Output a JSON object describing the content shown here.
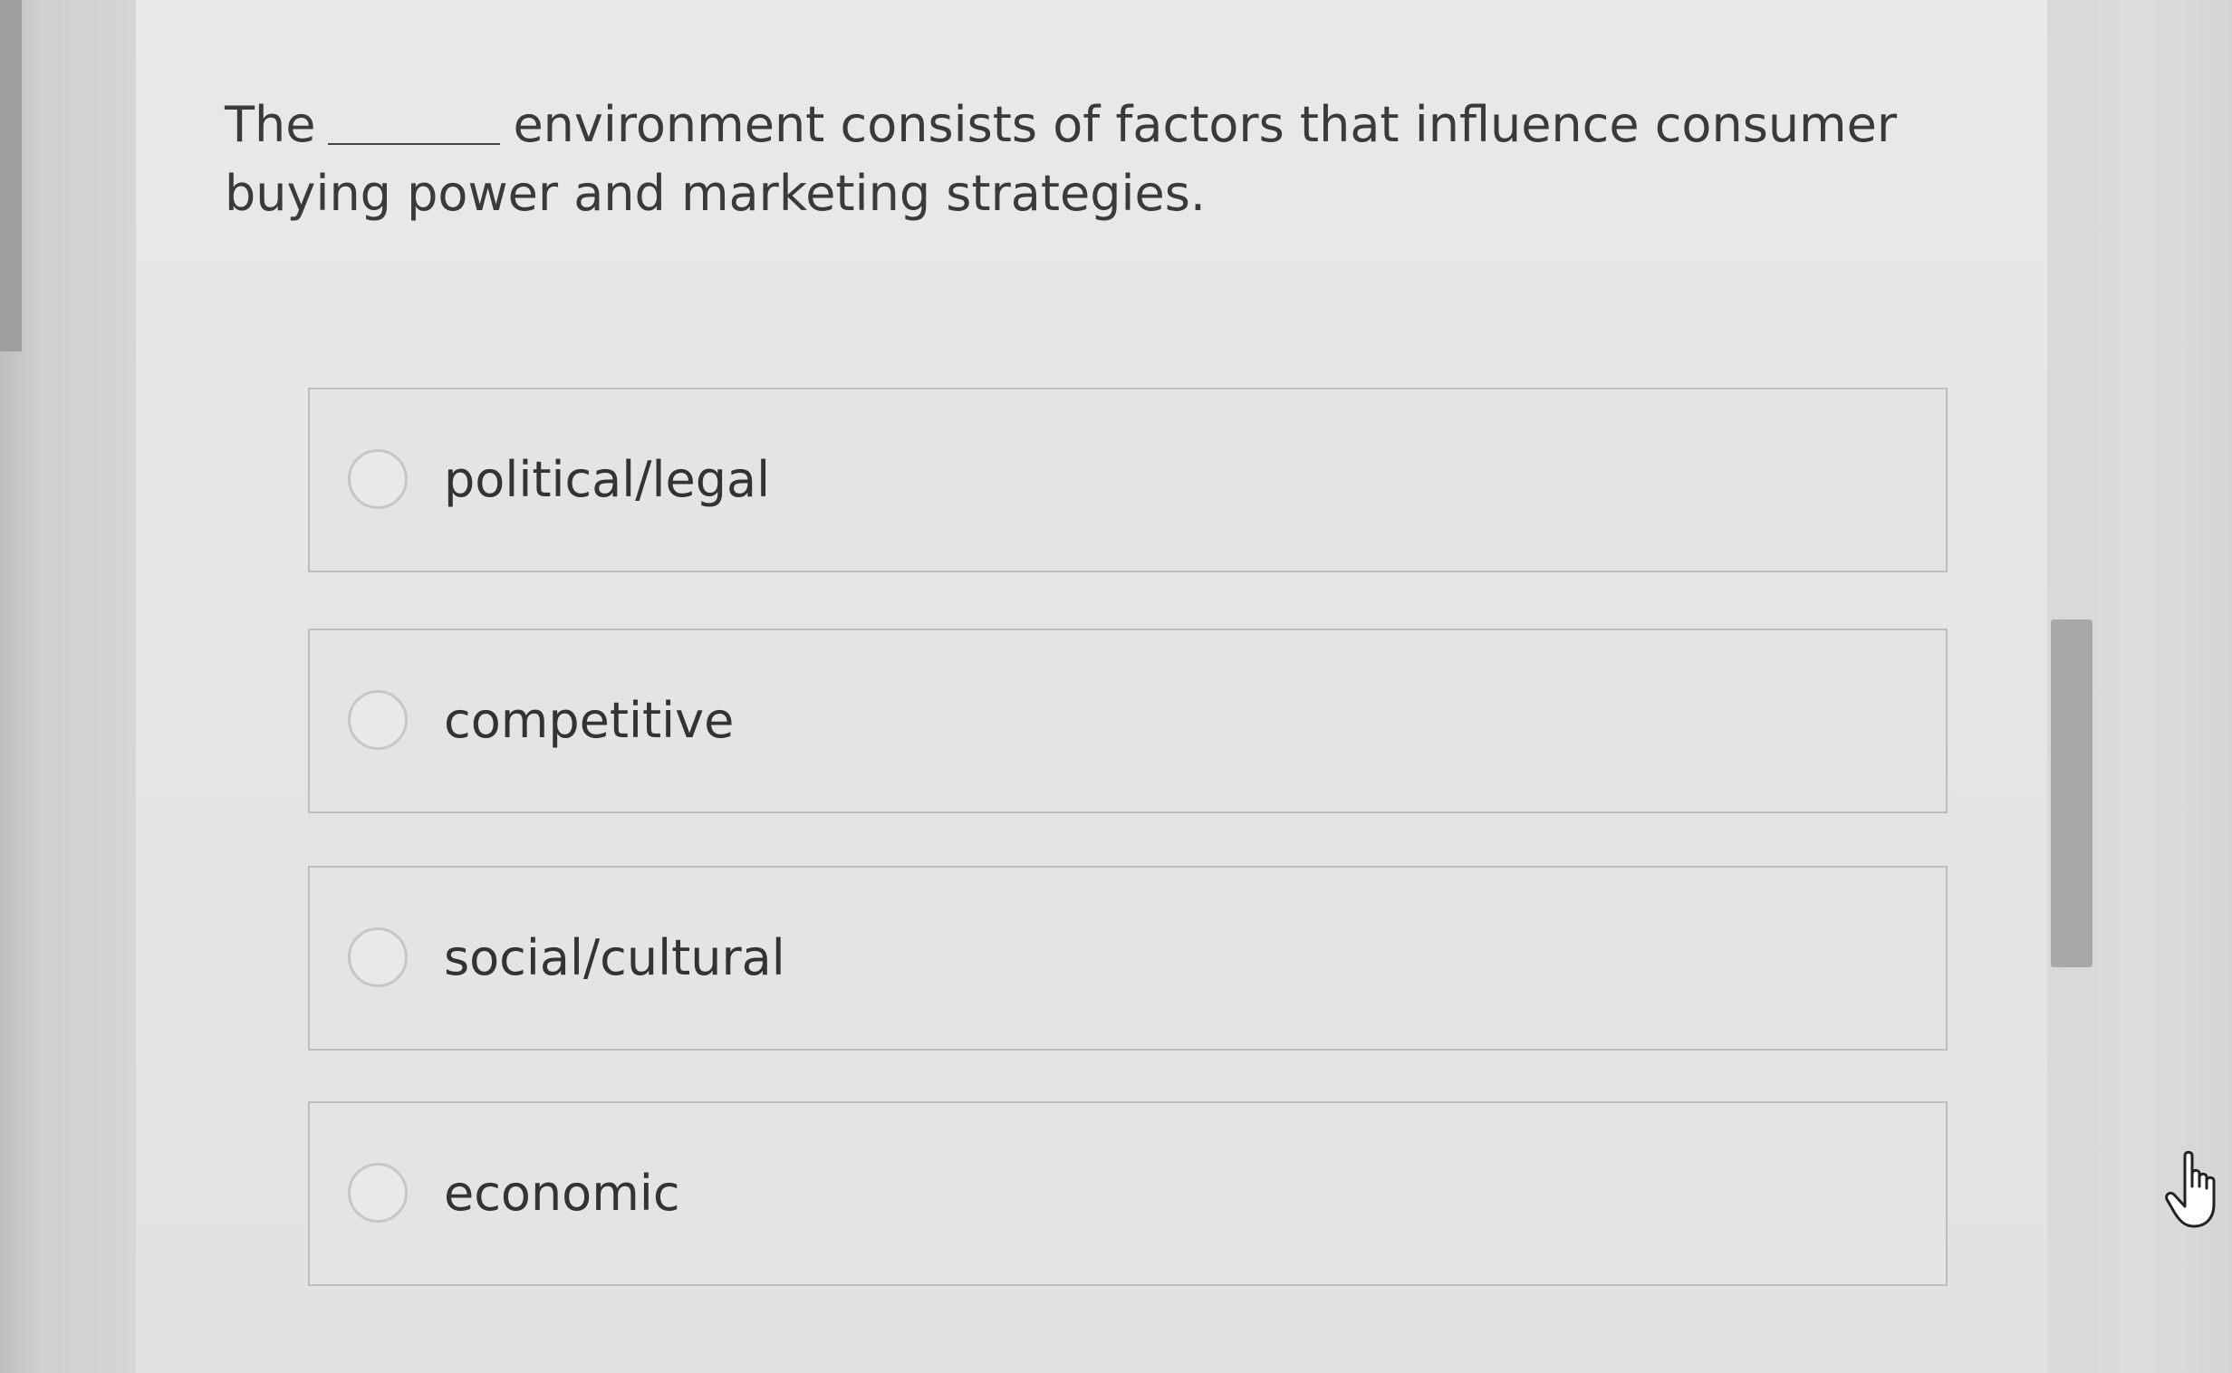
{
  "question": {
    "before_blank": "The",
    "after_blank": "environment consists of factors that influence consumer buying power and marketing strategies."
  },
  "options": [
    {
      "label": "political/legal",
      "selected": false
    },
    {
      "label": "competitive",
      "selected": false
    },
    {
      "label": "social/cultural",
      "selected": false
    },
    {
      "label": "economic",
      "selected": false
    }
  ],
  "icons": {
    "cursor": "hand-pointer-icon",
    "radio": "radio-button-icon"
  },
  "colors": {
    "text": "#3a3a3a",
    "option_border": "#bdbdbd",
    "scrollbar": "#a9a9a9"
  }
}
